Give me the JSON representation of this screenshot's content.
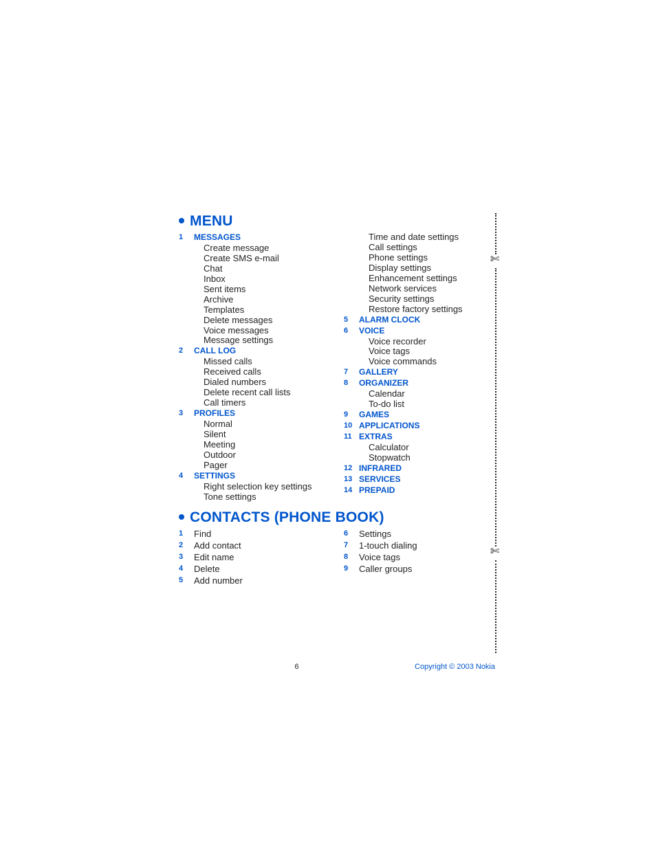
{
  "sections": [
    {
      "heading": "MENU",
      "columns": [
        [
          {
            "num": "1",
            "title": "MESSAGES",
            "items": [
              "Create message",
              "Create SMS e-mail",
              "Chat",
              "Inbox",
              "Sent items",
              "Archive",
              "Templates",
              "Delete messages",
              "Voice messages",
              "Message settings"
            ]
          },
          {
            "num": "2",
            "title": "CALL LOG",
            "items": [
              "Missed calls",
              "Received calls",
              "Dialed numbers",
              "Delete recent call lists",
              "Call timers"
            ]
          },
          {
            "num": "3",
            "title": "PROFILES",
            "items": [
              "Normal",
              "Silent",
              "Meeting",
              "Outdoor",
              "Pager"
            ]
          },
          {
            "num": "4",
            "title": "SETTINGS",
            "items": [
              "Right selection key settings",
              "Tone settings"
            ]
          }
        ],
        [
          {
            "num": "",
            "title": "",
            "items": [
              "Time and date settings",
              "Call settings",
              "Phone settings",
              "Display settings",
              "Enhancement settings",
              "Network services",
              "Security settings",
              "Restore factory settings"
            ]
          },
          {
            "num": "5",
            "title": "ALARM CLOCK",
            "items": []
          },
          {
            "num": "6",
            "title": "VOICE",
            "items": [
              "Voice recorder",
              "Voice tags",
              "Voice commands"
            ]
          },
          {
            "num": "7",
            "title": "GALLERY",
            "items": []
          },
          {
            "num": "8",
            "title": "ORGANIZER",
            "items": [
              "Calendar",
              "To-do list"
            ]
          },
          {
            "num": "9",
            "title": "GAMES",
            "items": []
          },
          {
            "num": "10",
            "title": "APPLICATIONS",
            "items": []
          },
          {
            "num": "11",
            "title": "EXTRAS",
            "items": [
              "Calculator",
              "Stopwatch"
            ]
          },
          {
            "num": "12",
            "title": "INFRARED",
            "items": []
          },
          {
            "num": "13",
            "title": "SERVICES",
            "items": []
          },
          {
            "num": "14",
            "title": "PREPAID",
            "items": []
          }
        ]
      ]
    },
    {
      "heading": "CONTACTS (PHONE BOOK)",
      "columns": [
        [
          {
            "num": "1",
            "title": "Find",
            "plain": true
          },
          {
            "num": "2",
            "title": "Add contact",
            "plain": true
          },
          {
            "num": "3",
            "title": "Edit name",
            "plain": true
          },
          {
            "num": "4",
            "title": "Delete",
            "plain": true
          },
          {
            "num": "5",
            "title": "Add number",
            "plain": true
          }
        ],
        [
          {
            "num": "6",
            "title": "Settings",
            "plain": true
          },
          {
            "num": "7",
            "title": "1-touch dialing",
            "plain": true
          },
          {
            "num": "8",
            "title": "Voice tags",
            "plain": true
          },
          {
            "num": "9",
            "title": "Caller groups",
            "plain": true
          }
        ]
      ]
    }
  ],
  "footer": {
    "page": "6",
    "copyright": "Copyright © 2003 Nokia"
  }
}
